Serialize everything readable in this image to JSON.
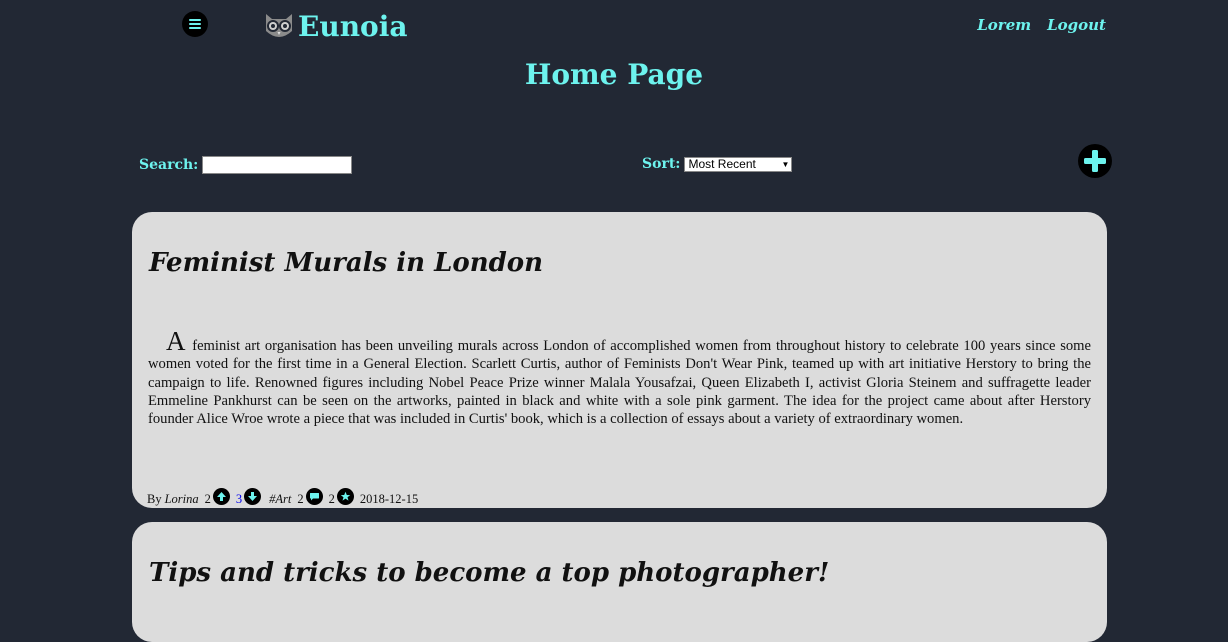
{
  "header": {
    "app_name": "Eunoia",
    "links": [
      "Lorem",
      "Logout"
    ],
    "page_title": "Home Page"
  },
  "toolbar": {
    "search_label": "Search:",
    "search_value": "",
    "sort_label": "Sort:",
    "sort_selected": "Most Recent"
  },
  "posts": [
    {
      "title": "Feminist Murals in London",
      "dropcap": "A",
      "body": " feminist art organisation has been unveiling murals across London of accomplished women from throughout history to celebrate 100 years since some women voted for the first time in a General Election. Scarlett Curtis, author of Feminists Don't Wear Pink, teamed up with art initiative Herstory to bring the campaign to life. Renowned figures including Nobel Peace Prize winner Malala Yousafzai, Queen Elizabeth I, activist Gloria Steinem and suffragette leader Emmeline Pankhurst can be seen on the artworks, painted in black and white with a sole pink garment. The idea for the project came about after Herstory founder Alice Wroe wrote a piece that was included in Curtis' book, which is a collection of essays about a variety of extraordinary women.",
      "by_label": "By",
      "author": "Lorina",
      "upvotes": "2",
      "downvotes": "3",
      "tag": "#Art",
      "comments": "2",
      "favorites": "2",
      "date": "2018-12-15"
    },
    {
      "title": "Tips and tricks to become a top photographer!"
    }
  ],
  "colors": {
    "background": "#222834",
    "accent": "#6df3ee",
    "card": "#dcdcdc",
    "icon_bg": "#000000"
  },
  "icons": {
    "menu": "hamburger-icon",
    "logo": "owl-icon",
    "add": "plus-icon",
    "upvote": "arrow-up-icon",
    "downvote": "arrow-down-icon",
    "comment": "comment-icon",
    "favorite": "star-icon"
  }
}
